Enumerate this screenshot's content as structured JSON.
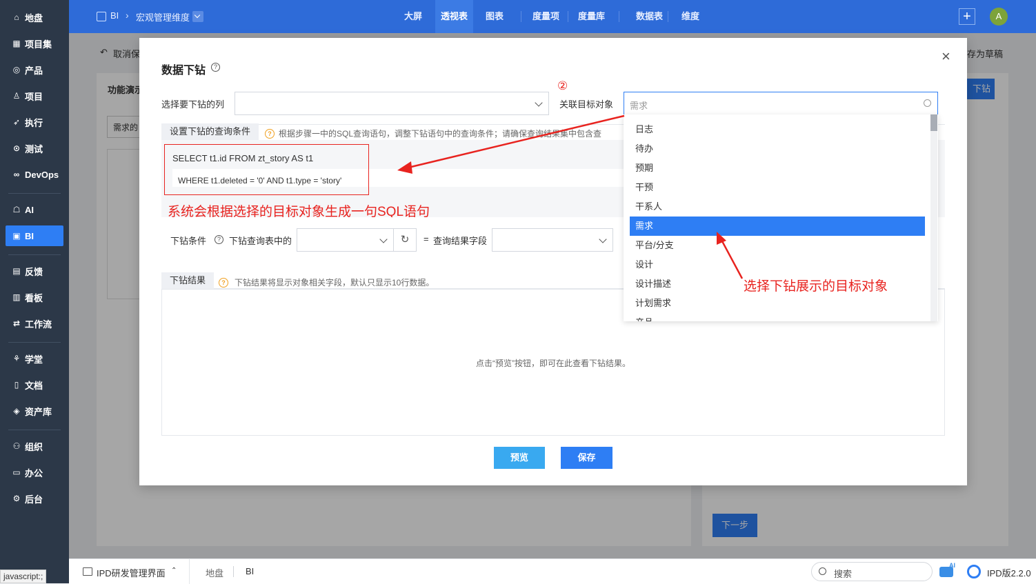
{
  "sidebar": {
    "items": [
      {
        "label": "地盘",
        "icon": "home-icon",
        "glyph": "⌂"
      },
      {
        "label": "项目集",
        "icon": "grid-icon",
        "glyph": "▦"
      },
      {
        "label": "产品",
        "icon": "location-icon",
        "glyph": "◎"
      },
      {
        "label": "项目",
        "icon": "person-icon",
        "glyph": "♙"
      },
      {
        "label": "执行",
        "icon": "rocket-icon",
        "glyph": "➶"
      },
      {
        "label": "测试",
        "icon": "test-icon",
        "glyph": "⊙"
      },
      {
        "label": "DevOps",
        "icon": "infinity-icon",
        "glyph": "∞"
      },
      {
        "label": "AI",
        "icon": "robot-icon",
        "glyph": "☖"
      },
      {
        "label": "BI",
        "icon": "chart-board-icon",
        "glyph": "▣"
      },
      {
        "label": "反馈",
        "icon": "feedback-icon",
        "glyph": "▤"
      },
      {
        "label": "看板",
        "icon": "kanban-icon",
        "glyph": "▥"
      },
      {
        "label": "工作流",
        "icon": "workflow-icon",
        "glyph": "⇄"
      },
      {
        "label": "学堂",
        "icon": "school-icon",
        "glyph": "⚘"
      },
      {
        "label": "文档",
        "icon": "document-icon",
        "glyph": "▯"
      },
      {
        "label": "资产库",
        "icon": "diamond-icon",
        "glyph": "◈"
      },
      {
        "label": "组织",
        "icon": "team-icon",
        "glyph": "⚇"
      },
      {
        "label": "办公",
        "icon": "office-icon",
        "glyph": "▭"
      },
      {
        "label": "后台",
        "icon": "settings-icon",
        "glyph": "⚙"
      }
    ]
  },
  "header": {
    "breadcrumb_root": "BI",
    "breadcrumb_sep": "›",
    "breadcrumb_current": "宏观管理维度",
    "nav": [
      "大屏",
      "透视表",
      "图表",
      "度量项",
      "度量库",
      "数据表",
      "维度"
    ],
    "avatar": "A",
    "add_glyph": "+"
  },
  "background": {
    "cancel_label": "取消保",
    "save_draft_label": "存为草稿",
    "panel_title": "功能演示",
    "drill_button": "下钻",
    "filter_value": "需求的",
    "next_button": "下一步"
  },
  "modal": {
    "title": "数据下钻",
    "close_glyph": "×",
    "select_column_label": "选择要下钻的列",
    "related_object_label": "关联目标对象",
    "related_object_value": "需求",
    "query_tab": "设置下钻的查询条件",
    "query_hint": "根据步骤一中的SQL查询语句，调整下钻语句中的查询条件；请确保查询结果集中包含查",
    "sql_line1": "SELECT t1.id FROM zt_story AS t1",
    "sql_line2": "WHERE t1.deleted = '0' AND t1.type = 'story'",
    "drill_condition_label": "下钻条件",
    "drill_query_table_label": "下钻查询表中的",
    "equals": "=",
    "query_result_field_label": "查询结果字段",
    "result_tab": "下钻结果",
    "result_hint": "下钻结果将显示对象相关字段，默认只显示10行数据。",
    "result_empty": "点击“预览”按钮，即可在此查看下钻结果。",
    "preview_button": "预览",
    "save_button": "保存"
  },
  "dropdown": {
    "options": [
      "日志",
      "待办",
      "预期",
      "干预",
      "干系人",
      "需求",
      "平台/分支",
      "设计",
      "设计描述",
      "计划需求",
      "产品"
    ],
    "selected": "需求"
  },
  "annotations": {
    "step_marker": "②",
    "sql_note": "系统会根据选择的目标对象生成一句SQL语句",
    "select_note": "选择下钻展示的目标对象"
  },
  "bottombar": {
    "app_label": "IPD研发管理界面",
    "crumb1": "地盘",
    "crumb2": "BI",
    "search_placeholder": "搜索",
    "ai_badge": "AI",
    "version": "IPD版2.2.0",
    "status_text": "javascript:;"
  },
  "colors": {
    "primary": "#2e7ef4",
    "header": "#2e6bd8",
    "sidebar": "#2c3848",
    "annotation": "#e8231f",
    "preview_button": "#39a9f0"
  }
}
